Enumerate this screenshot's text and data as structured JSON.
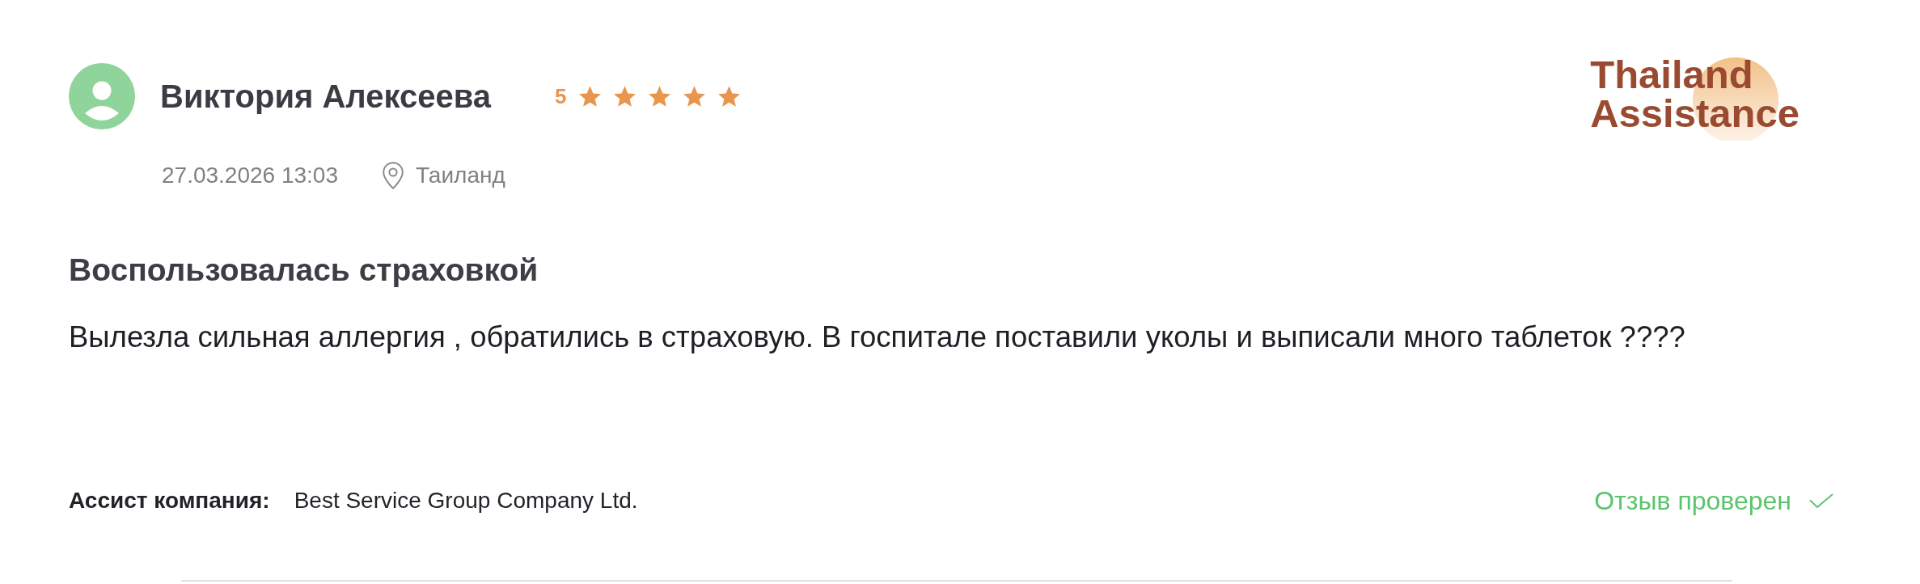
{
  "review": {
    "author": {
      "name": "Виктория Алексеева"
    },
    "rating": {
      "value": "5",
      "stars": 5
    },
    "date": "27.03.2026 13:03",
    "location": "Таиланд",
    "logo": {
      "lines": [
        "Thailand",
        "Assistance"
      ]
    },
    "title": "Воспользовалась страховкой",
    "text": "Вылезла сильная аллергия , обратились в страховую. В госпитале поставили уколы и выписали много таблеток ????",
    "assist_company": {
      "label": "Ассист компания:",
      "value": "Best Service Group Company Ltd."
    },
    "verification": {
      "label": "Отзыв проверен"
    }
  }
}
